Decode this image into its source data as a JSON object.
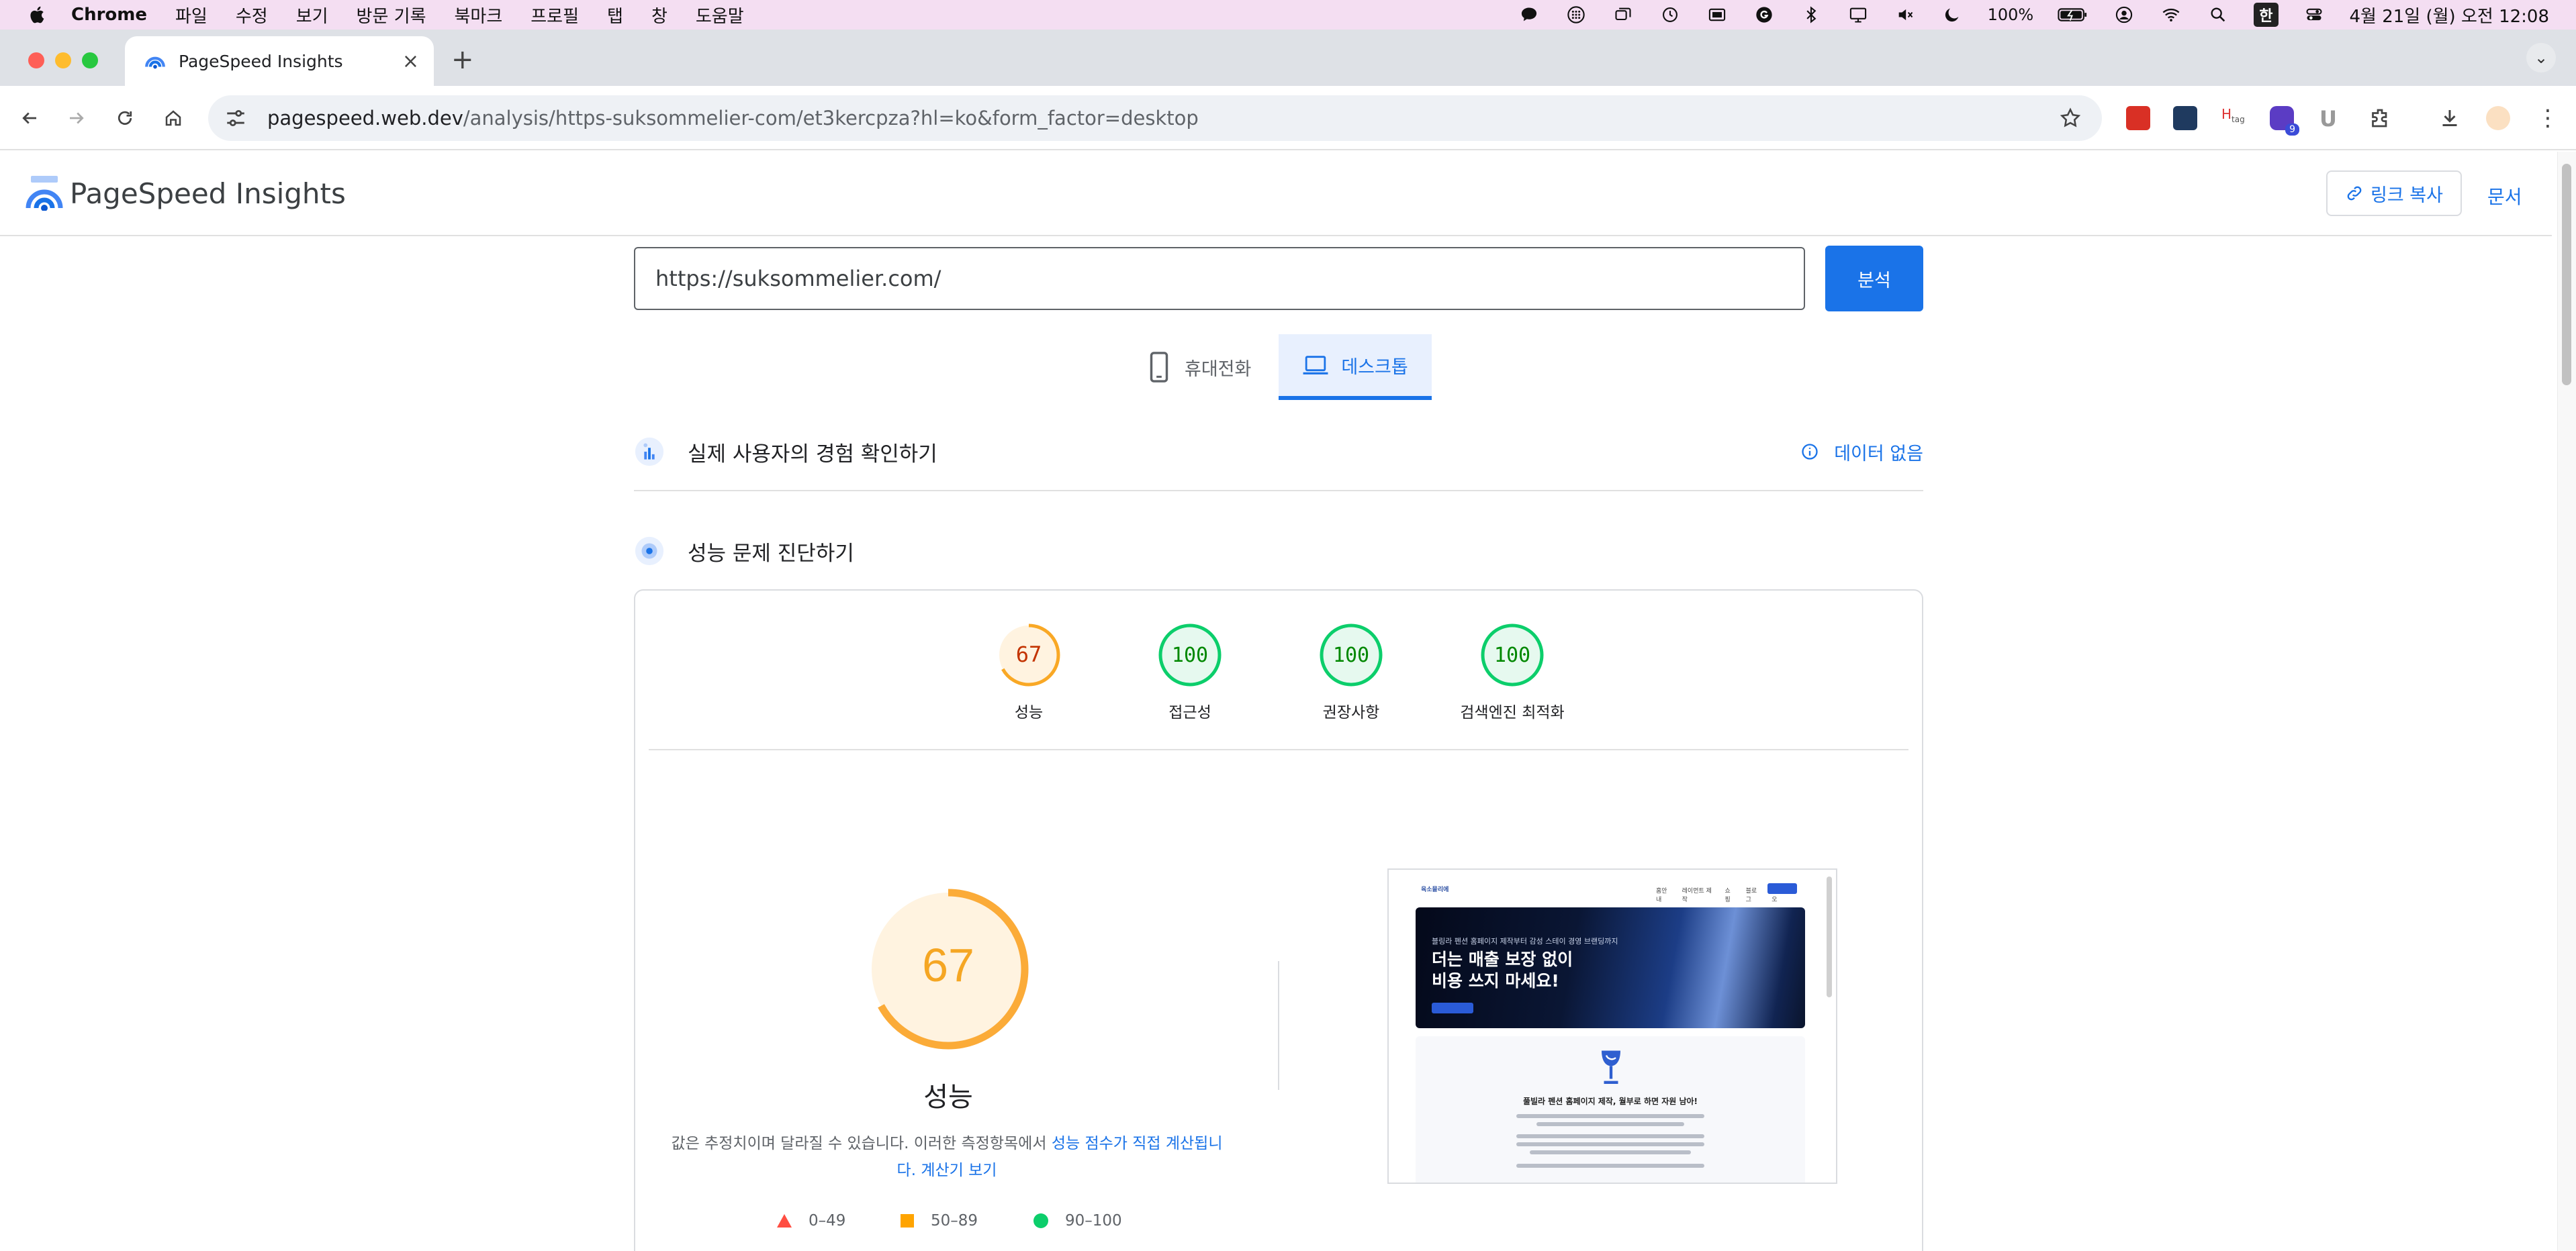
{
  "menubar": {
    "app_name": "Chrome",
    "menus": [
      "파일",
      "수정",
      "보기",
      "방문 기록",
      "북마크",
      "프로필",
      "탭",
      "창",
      "도움말"
    ],
    "battery": "100%",
    "input_method": "한",
    "datetime": "4월 21일 (월) 오전 12:08",
    "status_icons": [
      "speech-bubble-icon",
      "dots-grid-icon",
      "windows-icon",
      "time-machine-icon",
      "screen-mirror-icon",
      "grammarly-icon",
      "bluetooth-icon",
      "display-icon",
      "mute-icon",
      "dark-mode-icon",
      "battery-icon",
      "user-icon",
      "wifi-icon",
      "spotlight-icon",
      "control-center-icon"
    ]
  },
  "browser": {
    "tab_title": "PageSpeed Insights",
    "url_host": "pagespeed.web.dev",
    "url_path": "/analysis/https-suksommelier-com/et3kercpza?hl=ko&form_factor=desktop",
    "extension_badge": "9"
  },
  "header": {
    "title": "PageSpeed Insights",
    "copy_link": "링크 복사",
    "docs": "문서"
  },
  "form": {
    "url_value": "https://suksommelier.com/",
    "analyze_button": "분석"
  },
  "device_tabs": {
    "mobile": "휴대전화",
    "desktop": "데스크톱",
    "selected": "desktop"
  },
  "field_data": {
    "title": "실제 사용자의 경험 확인하기",
    "status": "데이터 없음"
  },
  "diagnose": {
    "title": "성능 문제 진단하기"
  },
  "scores": [
    {
      "label": "성능",
      "value": 67,
      "color": "#f9a825"
    },
    {
      "label": "접근성",
      "value": 100,
      "color": "#0cce6b"
    },
    {
      "label": "권장사항",
      "value": 100,
      "color": "#0cce6b"
    },
    {
      "label": "검색엔진 최적화",
      "value": 100,
      "color": "#0cce6b"
    }
  ],
  "performance": {
    "score": 67,
    "label": "성능",
    "description_prefix": "값은 추정치이며 달라질 수 있습니다. 이러한 측정항목에서 ",
    "description_link": "성능 점수가 직접 계산됩니다.",
    "calculator_link": "계산기 보기",
    "legend": [
      {
        "range": "0–49",
        "color": "#ff4e42",
        "shape": "triangle"
      },
      {
        "range": "50–89",
        "color": "#ffa400",
        "shape": "square"
      },
      {
        "range": "90–100",
        "color": "#0cce6b",
        "shape": "circle"
      }
    ]
  },
  "thumbnail": {
    "site_logo": "육소믈리에",
    "nav_items": [
      "홈안내",
      "레이먼트 제작",
      "쇼핑",
      "블로그",
      "포트폴리오"
    ],
    "hero_sub": "블링라 펜션 홈페이지 제작부터 감성 스테이 경영 브랜딩까지",
    "hero_heading_1": "더는 매출 보장 없이",
    "hero_heading_2": "비용 쓰지 마세요!",
    "card_title": "풀빌라 펜션 홈페이지 제작, 월부로 하면 자원 남아!"
  }
}
